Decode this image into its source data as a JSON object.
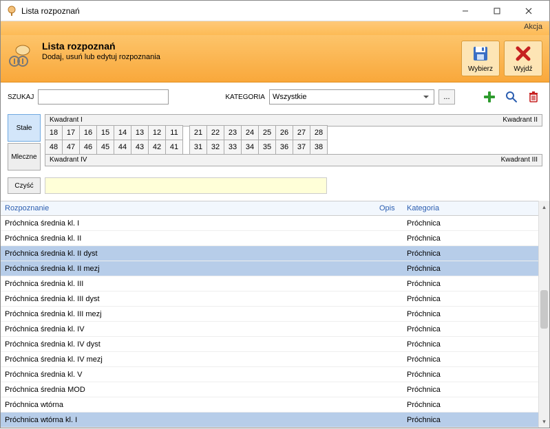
{
  "window": {
    "title": "Lista rozpoznań"
  },
  "menubar": {
    "akcja": "Akcja"
  },
  "header": {
    "title": "Lista rozpoznań",
    "subtitle": "Dodaj, usuń lub edytuj rozpoznania",
    "wybierz": "Wybierz",
    "wyjdz": "Wyjdź"
  },
  "toolbar": {
    "szukaj_label": "SZUKAJ",
    "search_value": "",
    "kategoria_label": "KATEGORIA",
    "kategoria_selected": "Wszystkie",
    "more": "..."
  },
  "tabs": {
    "stale": "Stałe",
    "mleczne": "Mleczne"
  },
  "quadrants": {
    "q1": "Kwadrant I",
    "q2": "Kwadrant II",
    "q3": "Kwadrant III",
    "q4": "Kwadrant IV"
  },
  "teeth_top_left": [
    "18",
    "17",
    "16",
    "15",
    "14",
    "13",
    "12",
    "11"
  ],
  "teeth_top_right": [
    "21",
    "22",
    "23",
    "24",
    "25",
    "26",
    "27",
    "28"
  ],
  "teeth_bot_left": [
    "48",
    "47",
    "46",
    "45",
    "44",
    "43",
    "42",
    "41"
  ],
  "teeth_bot_right": [
    "31",
    "32",
    "33",
    "34",
    "35",
    "36",
    "37",
    "38"
  ],
  "clear": {
    "btn": "Czyść"
  },
  "table": {
    "headers": {
      "rozpoznanie": "Rozpoznanie",
      "opis": "Opis",
      "kategoria": "Kategoria"
    },
    "rows": [
      {
        "r": "Próchnica średnia kl. I",
        "k": "Próchnica",
        "sel": false
      },
      {
        "r": "Próchnica średnia kl. II",
        "k": "Próchnica",
        "sel": false
      },
      {
        "r": "Próchnica średnia kl. II dyst",
        "k": "Próchnica",
        "sel": true
      },
      {
        "r": "Próchnica średnia kl. II mezj",
        "k": "Próchnica",
        "sel": true
      },
      {
        "r": "Próchnica średnia kl. III",
        "k": "Próchnica",
        "sel": false
      },
      {
        "r": "Próchnica średnia kl. III dyst",
        "k": "Próchnica",
        "sel": false
      },
      {
        "r": "Próchnica średnia kl. III mezj",
        "k": "Próchnica",
        "sel": false
      },
      {
        "r": "Próchnica średnia kl. IV",
        "k": "Próchnica",
        "sel": false
      },
      {
        "r": "Próchnica średnia kl. IV dyst",
        "k": "Próchnica",
        "sel": false
      },
      {
        "r": "Próchnica średnia kl. IV mezj",
        "k": "Próchnica",
        "sel": false
      },
      {
        "r": "Próchnica średnia kl. V",
        "k": "Próchnica",
        "sel": false
      },
      {
        "r": "Próchnica średnia MOD",
        "k": "Próchnica",
        "sel": false
      },
      {
        "r": "Próchnica wtórna",
        "k": "Próchnica",
        "sel": false
      },
      {
        "r": "Próchnica wtórna kl. I",
        "k": "Próchnica",
        "sel": true
      }
    ]
  }
}
